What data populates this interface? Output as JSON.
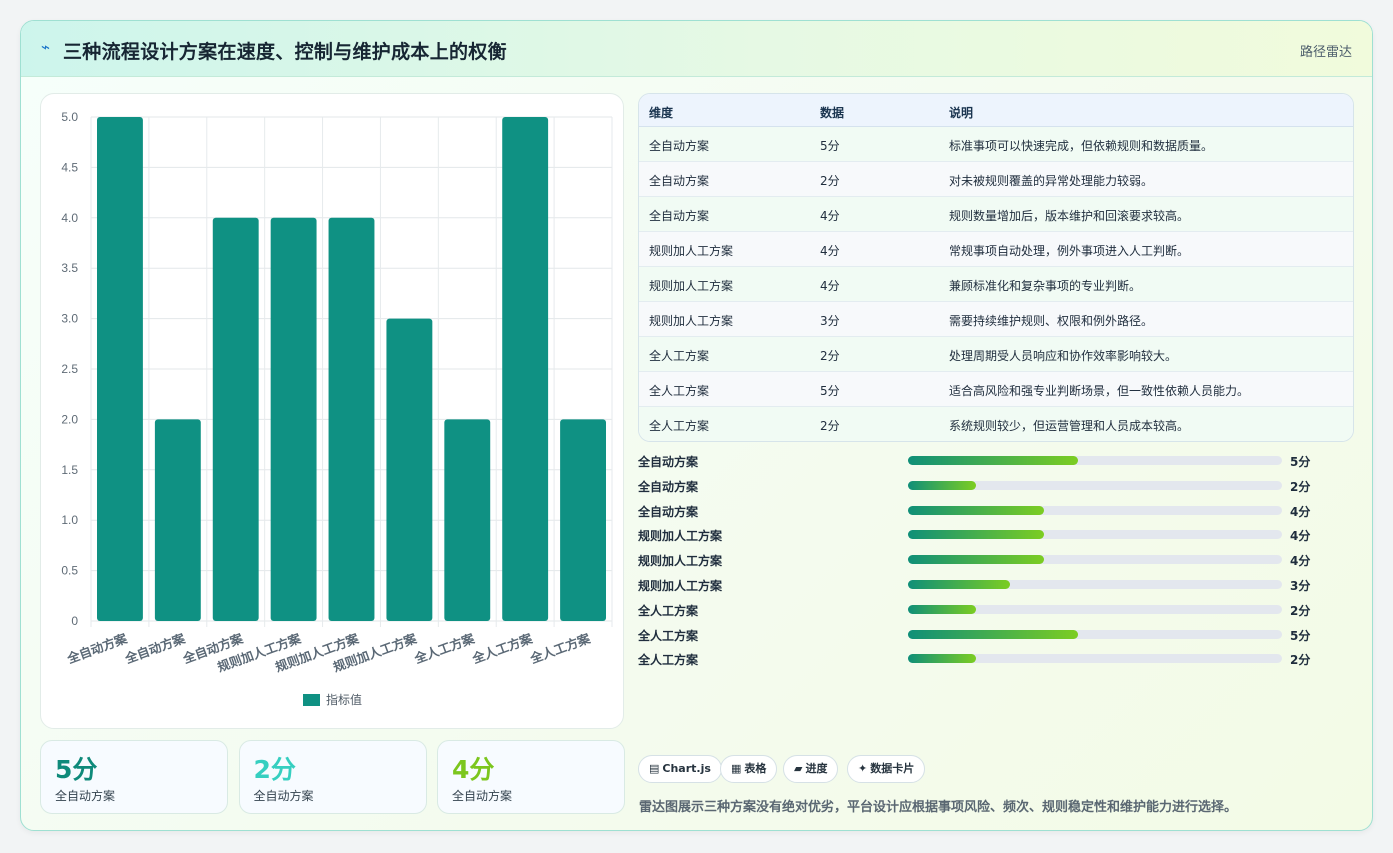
{
  "header": {
    "title": "三种流程设计方案在速度、控制与维护成本上的权衡",
    "tag": "路径雷达",
    "icon": "lightning-icon"
  },
  "chart_data": {
    "type": "bar",
    "categories": [
      "全自动方案",
      "全自动方案",
      "全自动方案",
      "规则加人工方案",
      "规则加人工方案",
      "规则加人工方案",
      "全人工方案",
      "全人工方案",
      "全人工方案"
    ],
    "series": [
      {
        "name": "指标值",
        "values": [
          5,
          2,
          4,
          4,
          4,
          3,
          2,
          5,
          2
        ]
      }
    ],
    "ylim": [
      0,
      5
    ],
    "yticks": [
      "0",
      "0.5",
      "1.0",
      "1.5",
      "2.0",
      "2.5",
      "3.0",
      "3.5",
      "4.0",
      "4.5",
      "5.0"
    ],
    "legend": "bottom",
    "grid": true,
    "bar_color": "#0f9183"
  },
  "kpis": [
    {
      "value": "5分",
      "label": "全自动方案",
      "color": "#0f8a7a"
    },
    {
      "value": "2分",
      "label": "全自动方案",
      "color": "#36cfc0"
    },
    {
      "value": "4分",
      "label": "全自动方案",
      "color": "#7cc61e"
    }
  ],
  "table": {
    "headers": [
      "维度",
      "数据",
      "说明"
    ],
    "rows": [
      [
        "全自动方案",
        "5分",
        "标准事项可以快速完成，但依赖规则和数据质量。"
      ],
      [
        "全自动方案",
        "2分",
        "对未被规则覆盖的异常处理能力较弱。"
      ],
      [
        "全自动方案",
        "4分",
        "规则数量增加后，版本维护和回滚要求较高。"
      ],
      [
        "规则加人工方案",
        "4分",
        "常规事项自动处理，例外事项进入人工判断。"
      ],
      [
        "规则加人工方案",
        "4分",
        "兼顾标准化和复杂事项的专业判断。"
      ],
      [
        "规则加人工方案",
        "3分",
        "需要持续维护规则、权限和例外路径。"
      ],
      [
        "全人工方案",
        "2分",
        "处理周期受人员响应和协作效率影响较大。"
      ],
      [
        "全人工方案",
        "5分",
        "适合高风险和强专业判断场景，但一致性依赖人员能力。"
      ],
      [
        "全人工方案",
        "2分",
        "系统规则较少，但运营管理和人员成本较高。"
      ]
    ]
  },
  "progress": [
    {
      "label": "全自动方案",
      "value": 5,
      "max": 11,
      "text": "5分"
    },
    {
      "label": "全自动方案",
      "value": 2,
      "max": 11,
      "text": "2分"
    },
    {
      "label": "全自动方案",
      "value": 4,
      "max": 11,
      "text": "4分"
    },
    {
      "label": "规则加人工方案",
      "value": 4,
      "max": 11,
      "text": "4分"
    },
    {
      "label": "规则加人工方案",
      "value": 4,
      "max": 11,
      "text": "4分"
    },
    {
      "label": "规则加人工方案",
      "value": 3,
      "max": 11,
      "text": "3分"
    },
    {
      "label": "全人工方案",
      "value": 2,
      "max": 11,
      "text": "2分"
    },
    {
      "label": "全人工方案",
      "value": 5,
      "max": 11,
      "text": "5分"
    },
    {
      "label": "全人工方案",
      "value": 2,
      "max": 11,
      "text": "2分"
    }
  ],
  "chips": [
    {
      "icon": "▤",
      "icon_name": "chart-icon",
      "label": "Chart.js"
    },
    {
      "icon": "▦",
      "icon_name": "table-icon",
      "label": "表格"
    },
    {
      "icon": "▰",
      "icon_name": "progress-icon",
      "label": "进度"
    },
    {
      "icon": "✦",
      "icon_name": "sparkle-icon",
      "label": "数据卡片"
    }
  ],
  "summary": "雷达图展示三种方案没有绝对优劣，平台设计应根据事项风险、频次、规则稳定性和维护能力进行选择。"
}
